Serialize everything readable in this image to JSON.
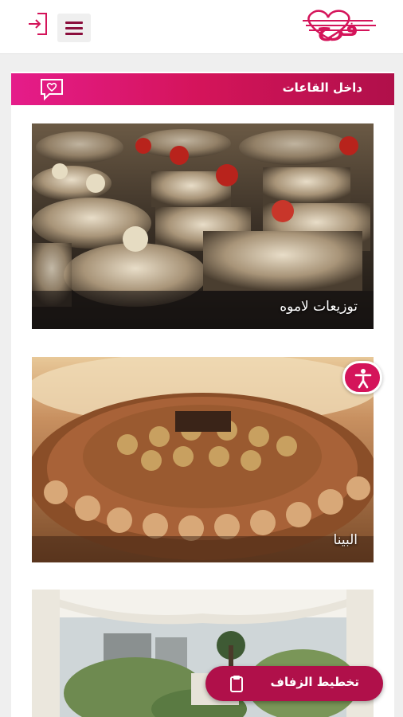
{
  "header": {
    "logo_text": "فرح",
    "logo_icon": "heart-wave-logo",
    "menu_icon": "hamburger-icon",
    "login_icon": "login-icon"
  },
  "section": {
    "title": "داخل القاعات",
    "icon": "chat-heart-icon"
  },
  "cards": [
    {
      "label": "توزيعات لاموه",
      "image": "silver-jewelry-boxes-photo"
    },
    {
      "label": "البينا",
      "image": "chocolate-platter-photo"
    },
    {
      "label": "",
      "image": "outdoor-tent-venue-photo"
    }
  ],
  "floating": {
    "accessibility_icon": "accessibility-icon",
    "plan_button_label": "تخطيط الزفاف",
    "plan_button_icon": "clipboard-icon"
  },
  "colors": {
    "brand": "#d4145a",
    "brand_dark": "#b0104a",
    "menu_bars": "#8b0f3d"
  }
}
